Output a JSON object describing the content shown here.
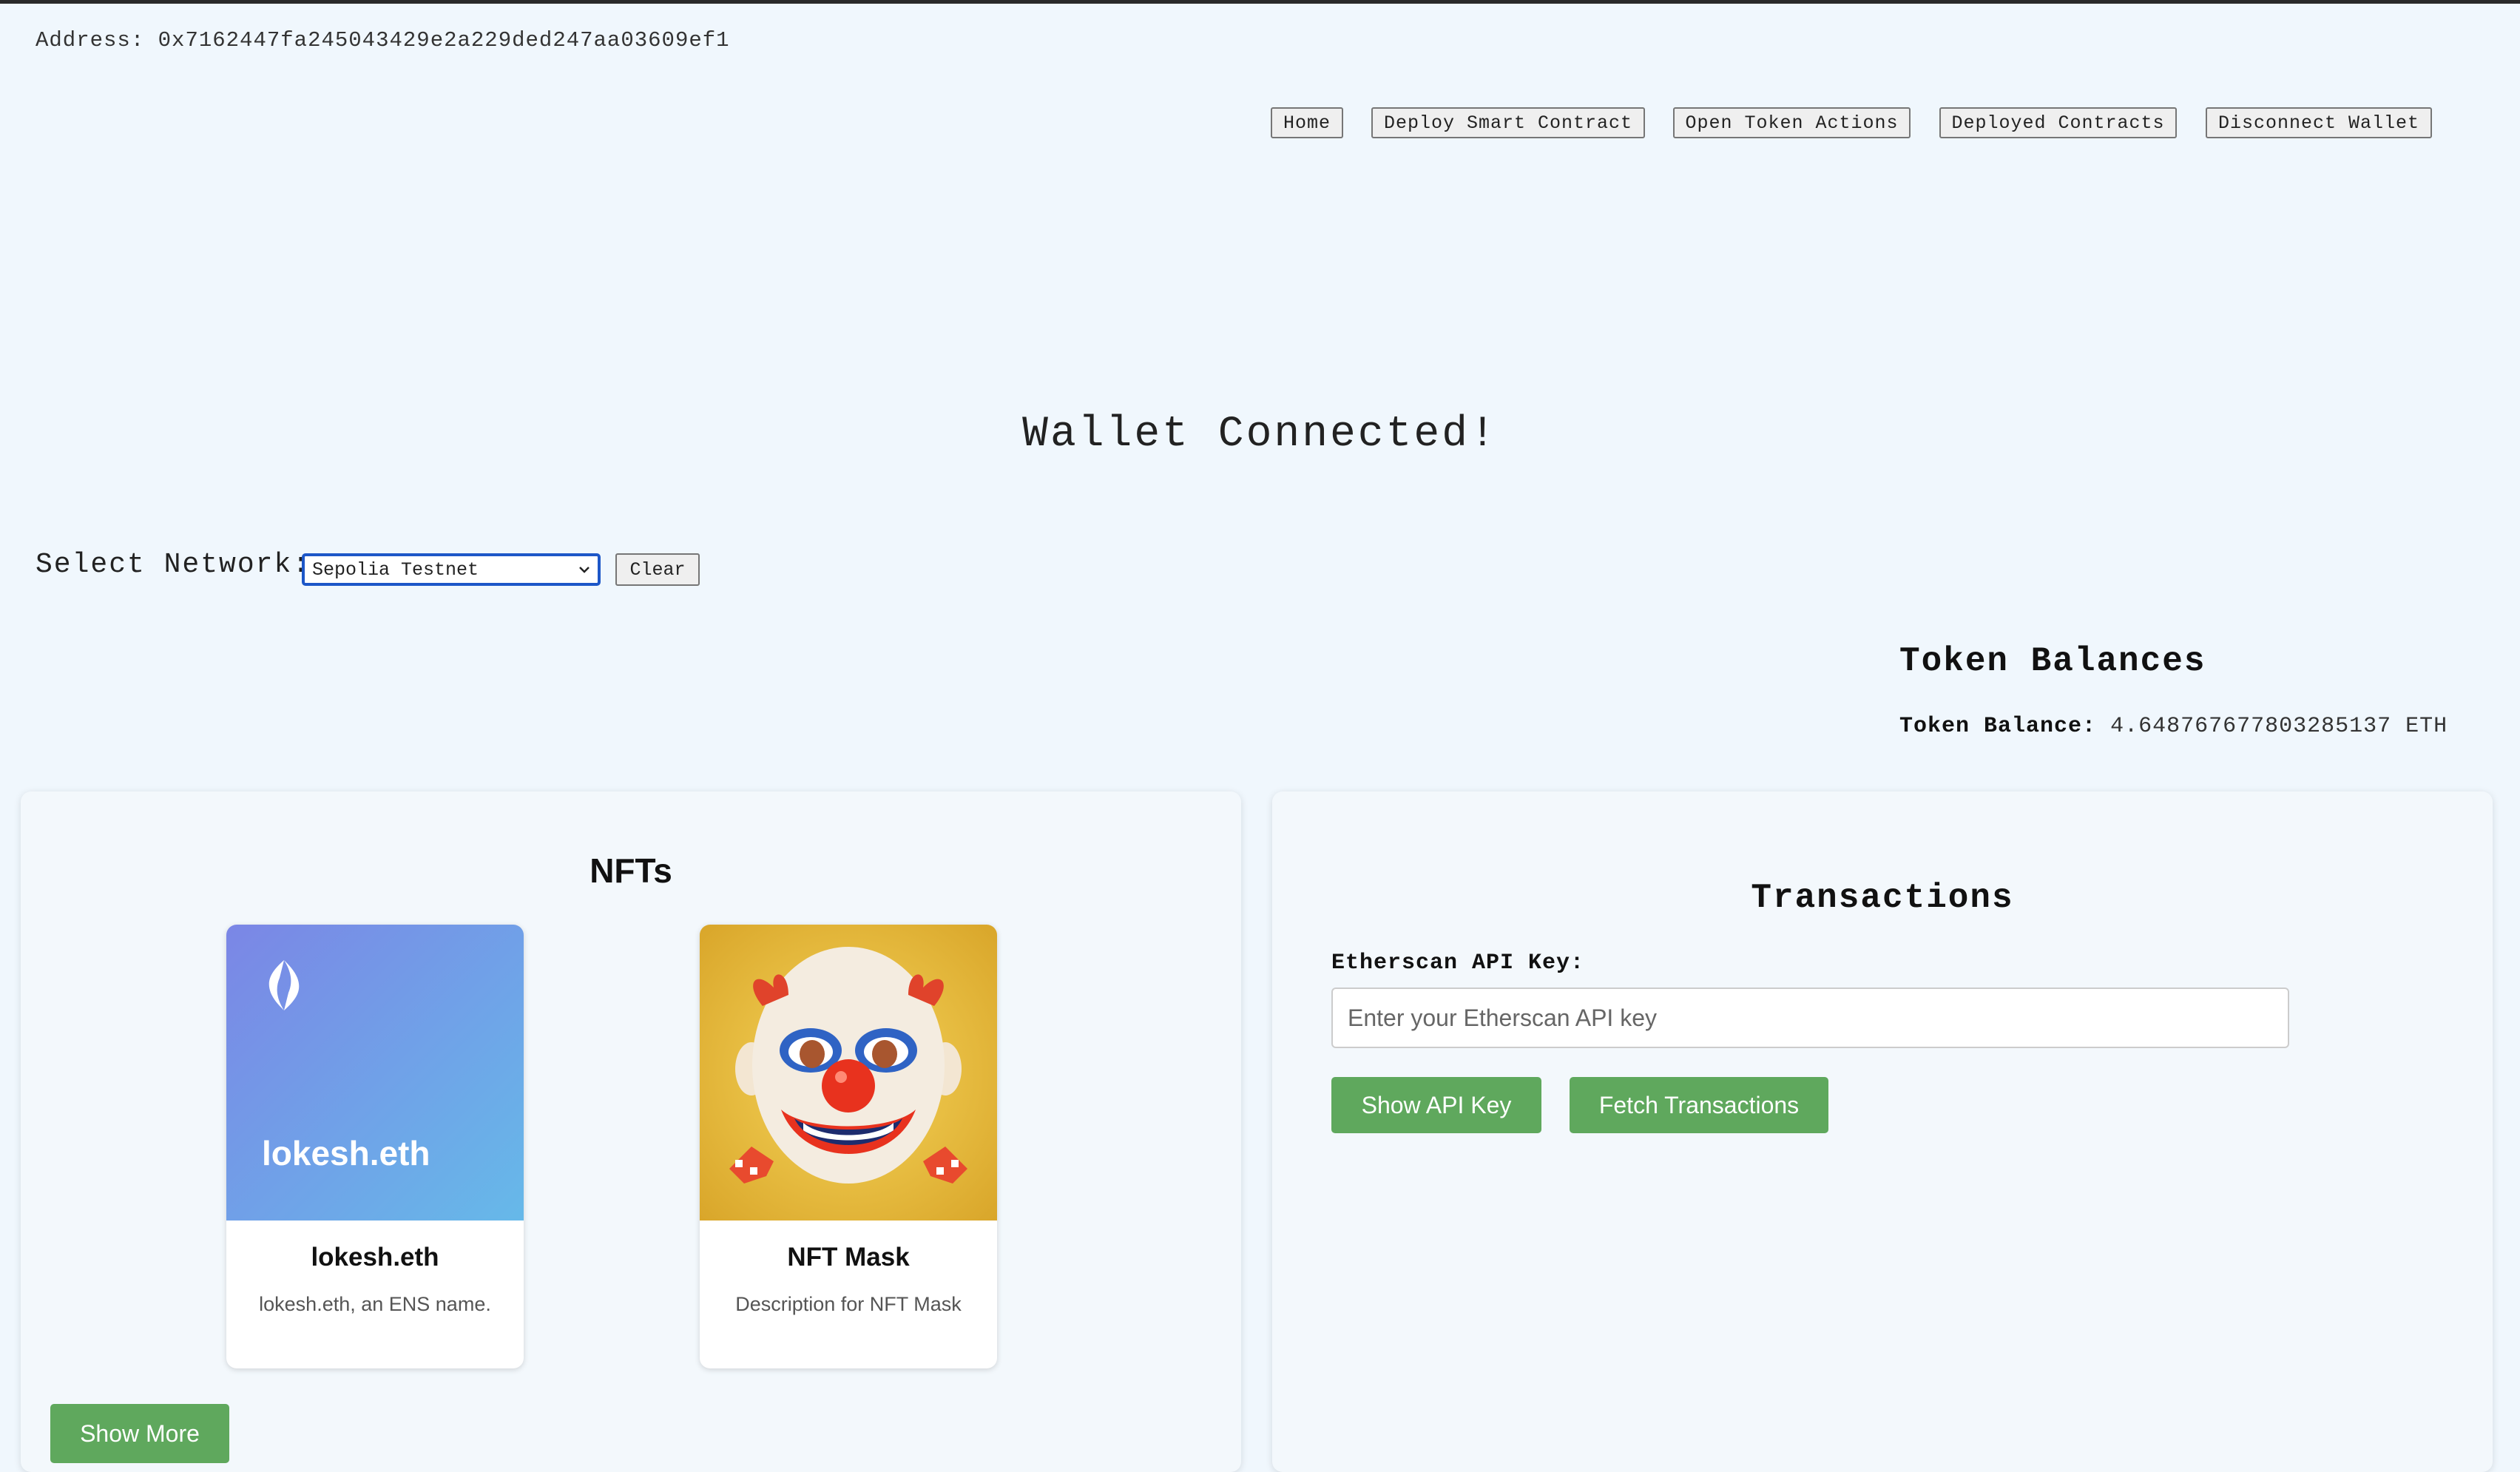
{
  "address": {
    "label": "Address:",
    "value": "0x7162447fa245043429e2a229ded247aa03609ef1"
  },
  "nav": {
    "home": "Home",
    "deploy": "Deploy Smart Contract",
    "token_actions": "Open Token Actions",
    "deployed": "Deployed Contracts",
    "disconnect": "Disconnect Wallet"
  },
  "status": {
    "title": "Wallet Connected!"
  },
  "network": {
    "label": "Select Network:",
    "selected": "Sepolia Testnet",
    "clear_label": "Clear"
  },
  "balances": {
    "title": "Token Balances",
    "label": "Token Balance:",
    "value": "4.648767677803285137 ETH"
  },
  "nfts": {
    "title": "NFTs",
    "items": [
      {
        "image_text": "lokesh.eth",
        "name": "lokesh.eth",
        "description": "lokesh.eth, an ENS name.",
        "icon": "ens-logo-icon"
      },
      {
        "name": "NFT Mask",
        "description": "Description for NFT Mask",
        "icon": "clown-mask-image"
      }
    ],
    "show_more_label": "Show More"
  },
  "transactions": {
    "title": "Transactions",
    "api_label": "Etherscan API Key:",
    "api_placeholder": "Enter your Etherscan API key",
    "api_value": "",
    "show_api_label": "Show API Key",
    "fetch_label": "Fetch Transactions"
  },
  "colors": {
    "background": "#f0f7fd",
    "button_green": "#5fa85d",
    "select_border": "#1d57c8",
    "ens_gradient_top": "#7b8ce8",
    "ens_gradient_bottom": "#6ab4e8",
    "mask_background": "#e8b832"
  }
}
